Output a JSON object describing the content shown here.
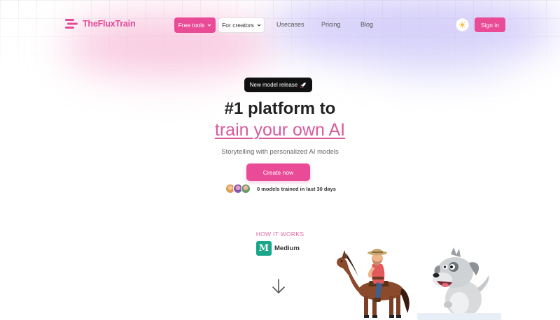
{
  "brand": {
    "name": "TheFluxTrain",
    "color": "#e34b97"
  },
  "nav": {
    "free_tools": "Free tools",
    "for_creators": "For creators",
    "usecases": "Usecases",
    "pricing": "Pricing",
    "blog": "Blog",
    "sign_in": "Sign in",
    "theme_icon": "sun-icon"
  },
  "hero": {
    "badge": "New model release",
    "badge_icon": "rocket-icon",
    "headline_line1": "#1 platform to",
    "headline_line2": "train your own AI",
    "subtitle": "Storytelling with personalized AI models",
    "cta": "Create now",
    "social_proof": "0 models trained in last 30 days"
  },
  "how_it_works": {
    "label": "HOW IT WORKS",
    "source_label": "Medium",
    "source_icon_text": "M",
    "arrow_icon": "arrow-down-icon"
  },
  "colors": {
    "accent": "#e94b97",
    "medium_green": "#1aa689"
  }
}
